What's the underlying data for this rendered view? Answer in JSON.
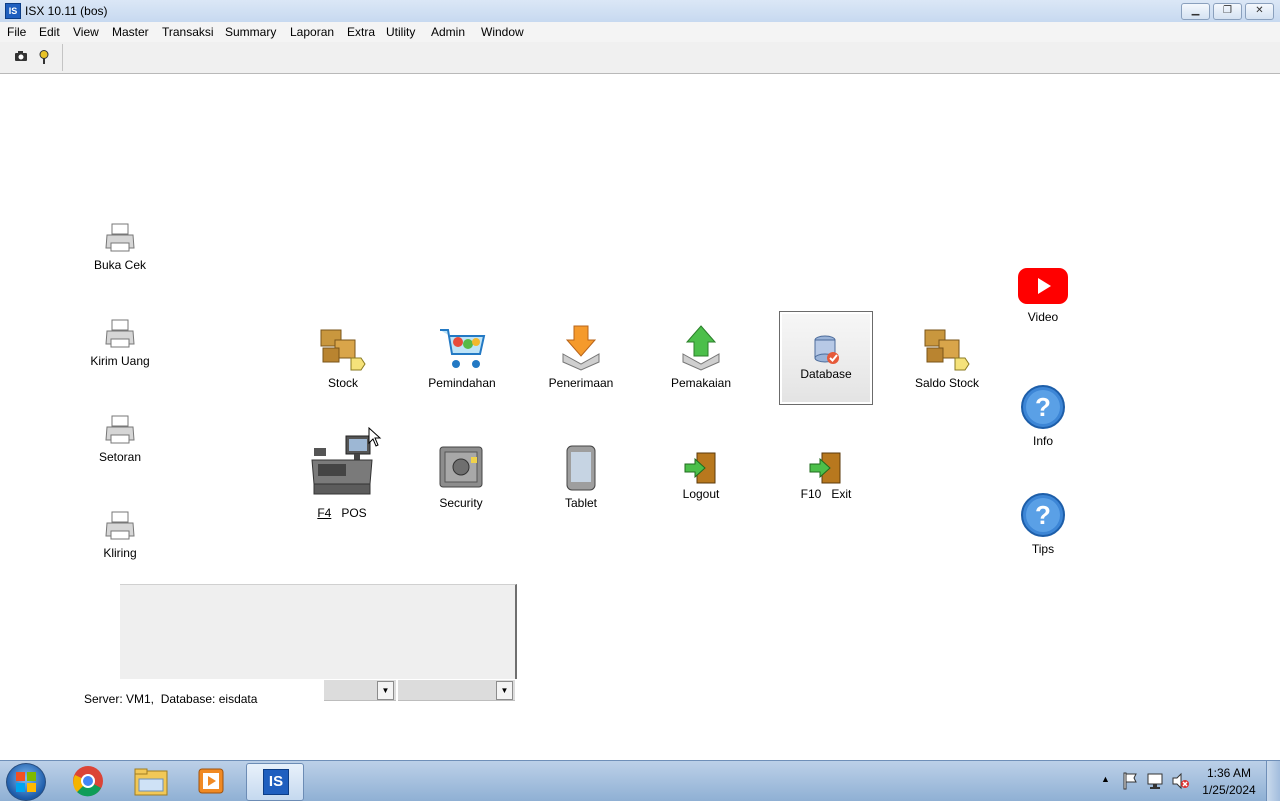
{
  "window": {
    "title": "ISX 10.11 (bos)",
    "app_icon_text": "IS",
    "controls": [
      "minimize-icon",
      "restore-icon",
      "close-icon"
    ]
  },
  "menu": [
    "File",
    "Edit",
    "View",
    "Master",
    "Transaksi",
    "Summary",
    "Laporan",
    "Extra",
    "Utility",
    "Admin",
    "Window"
  ],
  "toolbar": {
    "icons": [
      "camera-icon",
      "help-key-icon"
    ]
  },
  "left_column": [
    "Buka Cek",
    "Kirim Uang",
    "Setoran",
    "Kliring"
  ],
  "main_row1": [
    "Stock",
    "Pemindahan",
    "Penerimaan",
    "Pemakaian",
    "Database",
    "Saldo Stock"
  ],
  "main_row2": {
    "pos_key": "F4",
    "pos_label": "POS",
    "security": "Security",
    "tablet": "Tablet",
    "logout": "Logout",
    "exit_key": "F10",
    "exit_label": "Exit"
  },
  "right_column": [
    "Video",
    "Info",
    "Tips"
  ],
  "status": "Server: VM1,  Database: eisdata",
  "taskbar": {
    "apps": [
      "chrome-icon",
      "explorer-icon",
      "media-player-icon",
      "isx-icon"
    ],
    "isx_text": "IS",
    "time": "1:36 AM",
    "date": "1/25/2024"
  },
  "colors": {
    "youtube_red": "#ff0000",
    "help_blue": "#3d86d6",
    "taskbar_blue": "#a9c2e0"
  }
}
